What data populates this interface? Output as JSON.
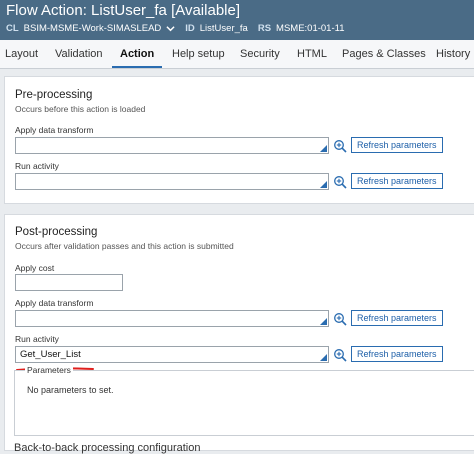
{
  "header": {
    "title": "Flow Action: ListUser_fa [Available]",
    "cl_key": "CL",
    "cl_value": "BSIM-MSME-Work-SIMASLEAD",
    "id_key": "ID",
    "id_value": "ListUser_fa",
    "rs_key": "RS",
    "rs_value": "MSME:01-01-11"
  },
  "tabs": [
    {
      "label": "Layout"
    },
    {
      "label": "Validation"
    },
    {
      "label": "Action"
    },
    {
      "label": "Help setup"
    },
    {
      "label": "Security"
    },
    {
      "label": "HTML"
    },
    {
      "label": "Pages & Classes"
    },
    {
      "label": "History"
    }
  ],
  "active_tab": "Action",
  "pre": {
    "title": "Pre-processing",
    "desc": "Occurs before this action is loaded",
    "transform_label": "Apply data transform",
    "transform_value": "",
    "activity_label": "Run activity",
    "activity_value": "",
    "refresh_label": "Refresh parameters"
  },
  "post": {
    "title": "Post-processing",
    "desc": "Occurs after validation passes and this action is submitted",
    "cost_label": "Apply cost",
    "transform_label": "Apply data transform",
    "transform_value": "",
    "activity_label": "Run activity",
    "activity_value": "Get_User_List",
    "refresh_label": "Refresh parameters",
    "params_label": "Parameters",
    "params_empty": "No parameters to set."
  },
  "back_title": "Back-to-back processing configuration",
  "colors": {
    "header_bg": "#4a6b86",
    "accent": "#2a6cb0",
    "annotation": "#e0201e"
  }
}
